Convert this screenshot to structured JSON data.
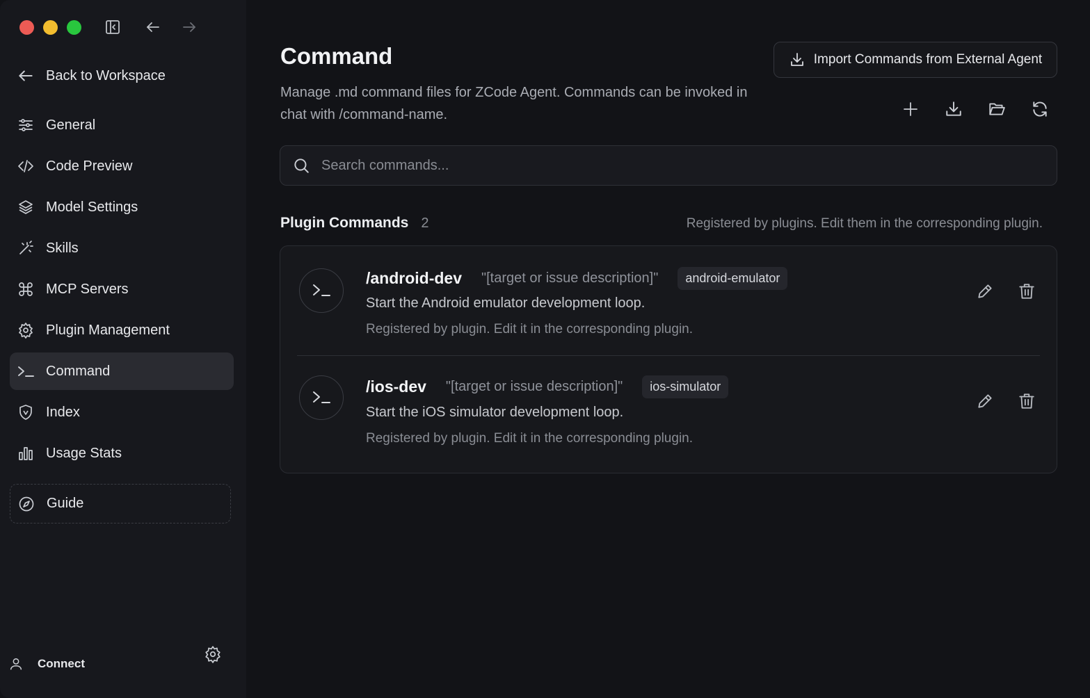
{
  "window": {
    "traffic_lights": {
      "close": "#ed5b55",
      "minimize": "#f3bd2f",
      "maximize": "#29c73e"
    }
  },
  "sidebar": {
    "back_label": "Back to Workspace",
    "items": [
      {
        "label": "General",
        "icon": "sliders-icon"
      },
      {
        "label": "Code Preview",
        "icon": "code-icon"
      },
      {
        "label": "Model Settings",
        "icon": "layers-icon"
      },
      {
        "label": "Skills",
        "icon": "magic-wand-icon"
      },
      {
        "label": "MCP Servers",
        "icon": "command-key-icon"
      },
      {
        "label": "Plugin Management",
        "icon": "gear-icon"
      },
      {
        "label": "Command",
        "icon": "terminal-icon",
        "active": true
      },
      {
        "label": "Index",
        "icon": "shield-icon"
      },
      {
        "label": "Usage Stats",
        "icon": "bar-chart-icon"
      }
    ],
    "guide_label": "Guide",
    "connect_label": "Connect"
  },
  "main": {
    "title": "Command",
    "description": "Manage .md command files for ZCode Agent. Commands can be invoked in chat with /command-name.",
    "import_label": "Import Commands from External Agent",
    "search_placeholder": "Search commands...",
    "section": {
      "title": "Plugin Commands",
      "count": "2",
      "note": "Registered by plugins. Edit them in the corresponding plugin."
    },
    "commands": [
      {
        "name": "/android-dev",
        "args": "\"[target or issue description]\"",
        "tag": "android-emulator",
        "description": "Start the Android emulator development loop.",
        "note": "Registered by plugin. Edit it in the corresponding plugin."
      },
      {
        "name": "/ios-dev",
        "args": "\"[target or issue description]\"",
        "tag": "ios-simulator",
        "description": "Start the iOS simulator development loop.",
        "note": "Registered by plugin. Edit it in the corresponding plugin."
      }
    ]
  },
  "colors": {
    "background": "#121317",
    "sidebar": "#17181d",
    "active_item": "#2a2b31",
    "card": "#17181c",
    "text_primary": "#e8e9ec",
    "text_muted": "#8a8d94"
  }
}
